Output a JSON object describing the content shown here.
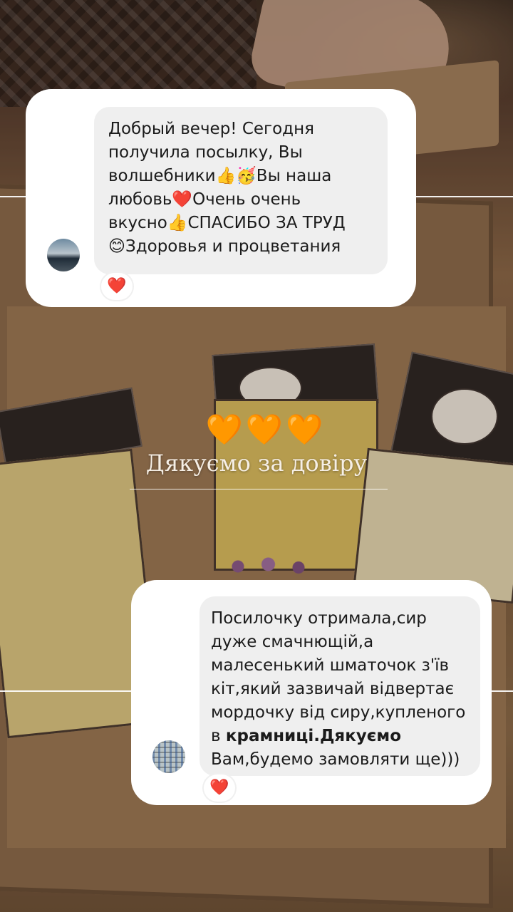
{
  "review_one": {
    "lines": [
      "Добрый вечер! Сегодня",
      "получила посылку, Вы",
      "волшебники👍🥳Вы наша",
      "любовь❤️Очень очень",
      "вкусно👍СПАСИБО ЗА ТРУД",
      "😊Здоровья и процветания"
    ],
    "reaction": "❤️"
  },
  "center": {
    "hearts": [
      "🧡",
      "🧡",
      "🧡"
    ],
    "caption": "Дякуємо за довіру"
  },
  "review_two": {
    "lines": [
      "Посилочку отримала,сир",
      "дуже смачнющій,а",
      "малесенький шматочок з'їв",
      "кіт,який зазвичай відвертає",
      "мордочку від сиру,купленого",
      "в "
    ],
    "line6_bold": "крамниці.Дякуємо",
    "line7": "Вам,будемо замовляти ще)))",
    "reaction": "❤️"
  },
  "colors": {
    "bubble": "#efefef",
    "heart_red": "#e0283b",
    "heart_orange": "#f39a12"
  }
}
